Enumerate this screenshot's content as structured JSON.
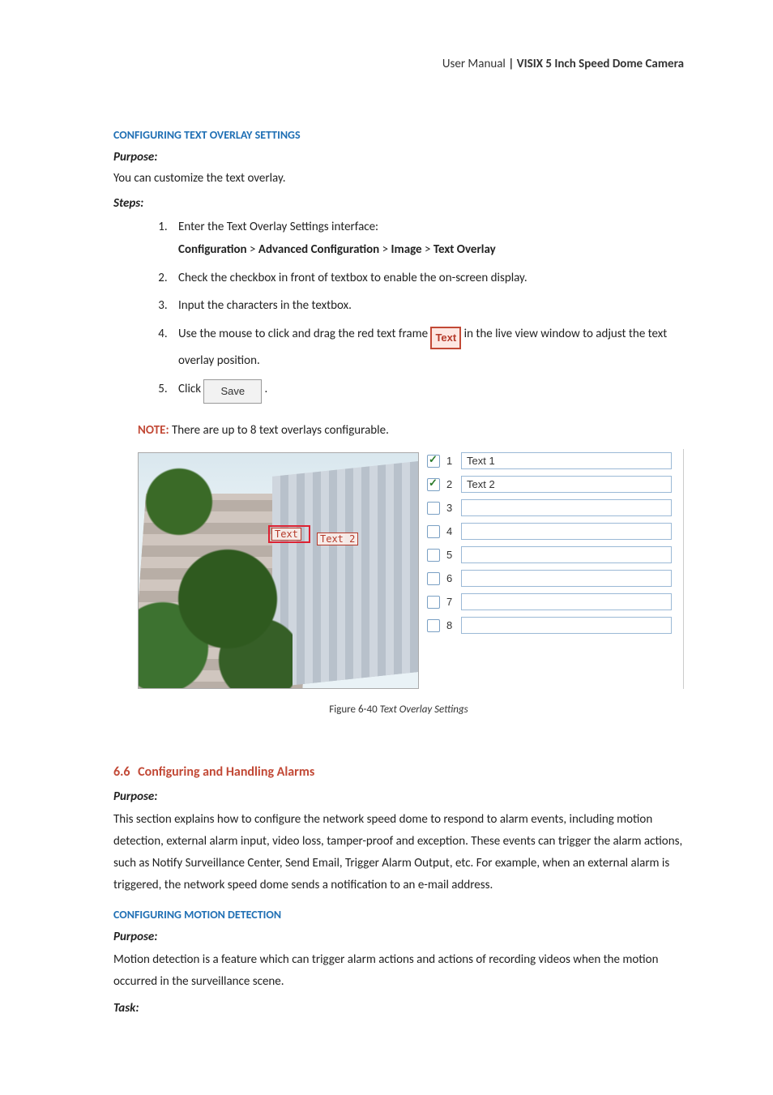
{
  "header": {
    "left": "User Manual",
    "separator": " | ",
    "right": "VISIX 5 Inch Speed Dome Camera"
  },
  "sec1": {
    "heading": "CONFIGURING TEXT OVERLAY SETTINGS",
    "purpose_label": "Purpose:",
    "purpose_text": "You can customize the text overlay.",
    "steps_label": "Steps:",
    "step1": "Enter the Text Overlay Settings interface:",
    "step1_path_a": "Configuration",
    "step1_path_b": "Advanced Configuration",
    "step1_path_c": "Image",
    "step1_path_d": "Text Overlay",
    "step2": "Check the checkbox in front of textbox to enable the on-screen display.",
    "step3": "Input the characters in the textbox.",
    "step4_a": "Use the mouse to click and drag the red text frame ",
    "step4_frame": "Text",
    "step4_b": " in the live view window to adjust the text overlay position.",
    "step5_a": "Click ",
    "step5_btn": "Save",
    "step5_b": ".",
    "note_label": "NOTE:",
    "note_text": " There are up to 8 text overlays configurable."
  },
  "figure": {
    "overlay1": "Text",
    "overlay2": "Text 2",
    "rows": [
      {
        "n": "1",
        "checked": true,
        "value": "Text 1"
      },
      {
        "n": "2",
        "checked": true,
        "value": "Text 2"
      },
      {
        "n": "3",
        "checked": false,
        "value": ""
      },
      {
        "n": "4",
        "checked": false,
        "value": ""
      },
      {
        "n": "5",
        "checked": false,
        "value": ""
      },
      {
        "n": "6",
        "checked": false,
        "value": ""
      },
      {
        "n": "7",
        "checked": false,
        "value": ""
      },
      {
        "n": "8",
        "checked": false,
        "value": ""
      }
    ],
    "caption_a": "Figure 6-40 ",
    "caption_b": "Text Overlay Settings"
  },
  "sec2": {
    "num": "6.6",
    "title": "Configuring and Handling Alarms",
    "purpose_label": "Purpose:",
    "body": "This section explains how to configure the network speed dome to respond to alarm events, including motion detection, external alarm input, video loss, tamper-proof and exception. These events can trigger the alarm actions, such as Notify Surveillance Center, Send Email, Trigger Alarm Output, etc. For example, when an external alarm is triggered, the network speed dome sends a notification to an e-mail address."
  },
  "sec3": {
    "heading": "CONFIGURING MOTION DETECTION",
    "purpose_label": "Purpose:",
    "body": "Motion detection is a feature which can trigger alarm actions and actions of recording videos when the motion occurred in the surveillance scene.",
    "task_label": "Task:"
  }
}
